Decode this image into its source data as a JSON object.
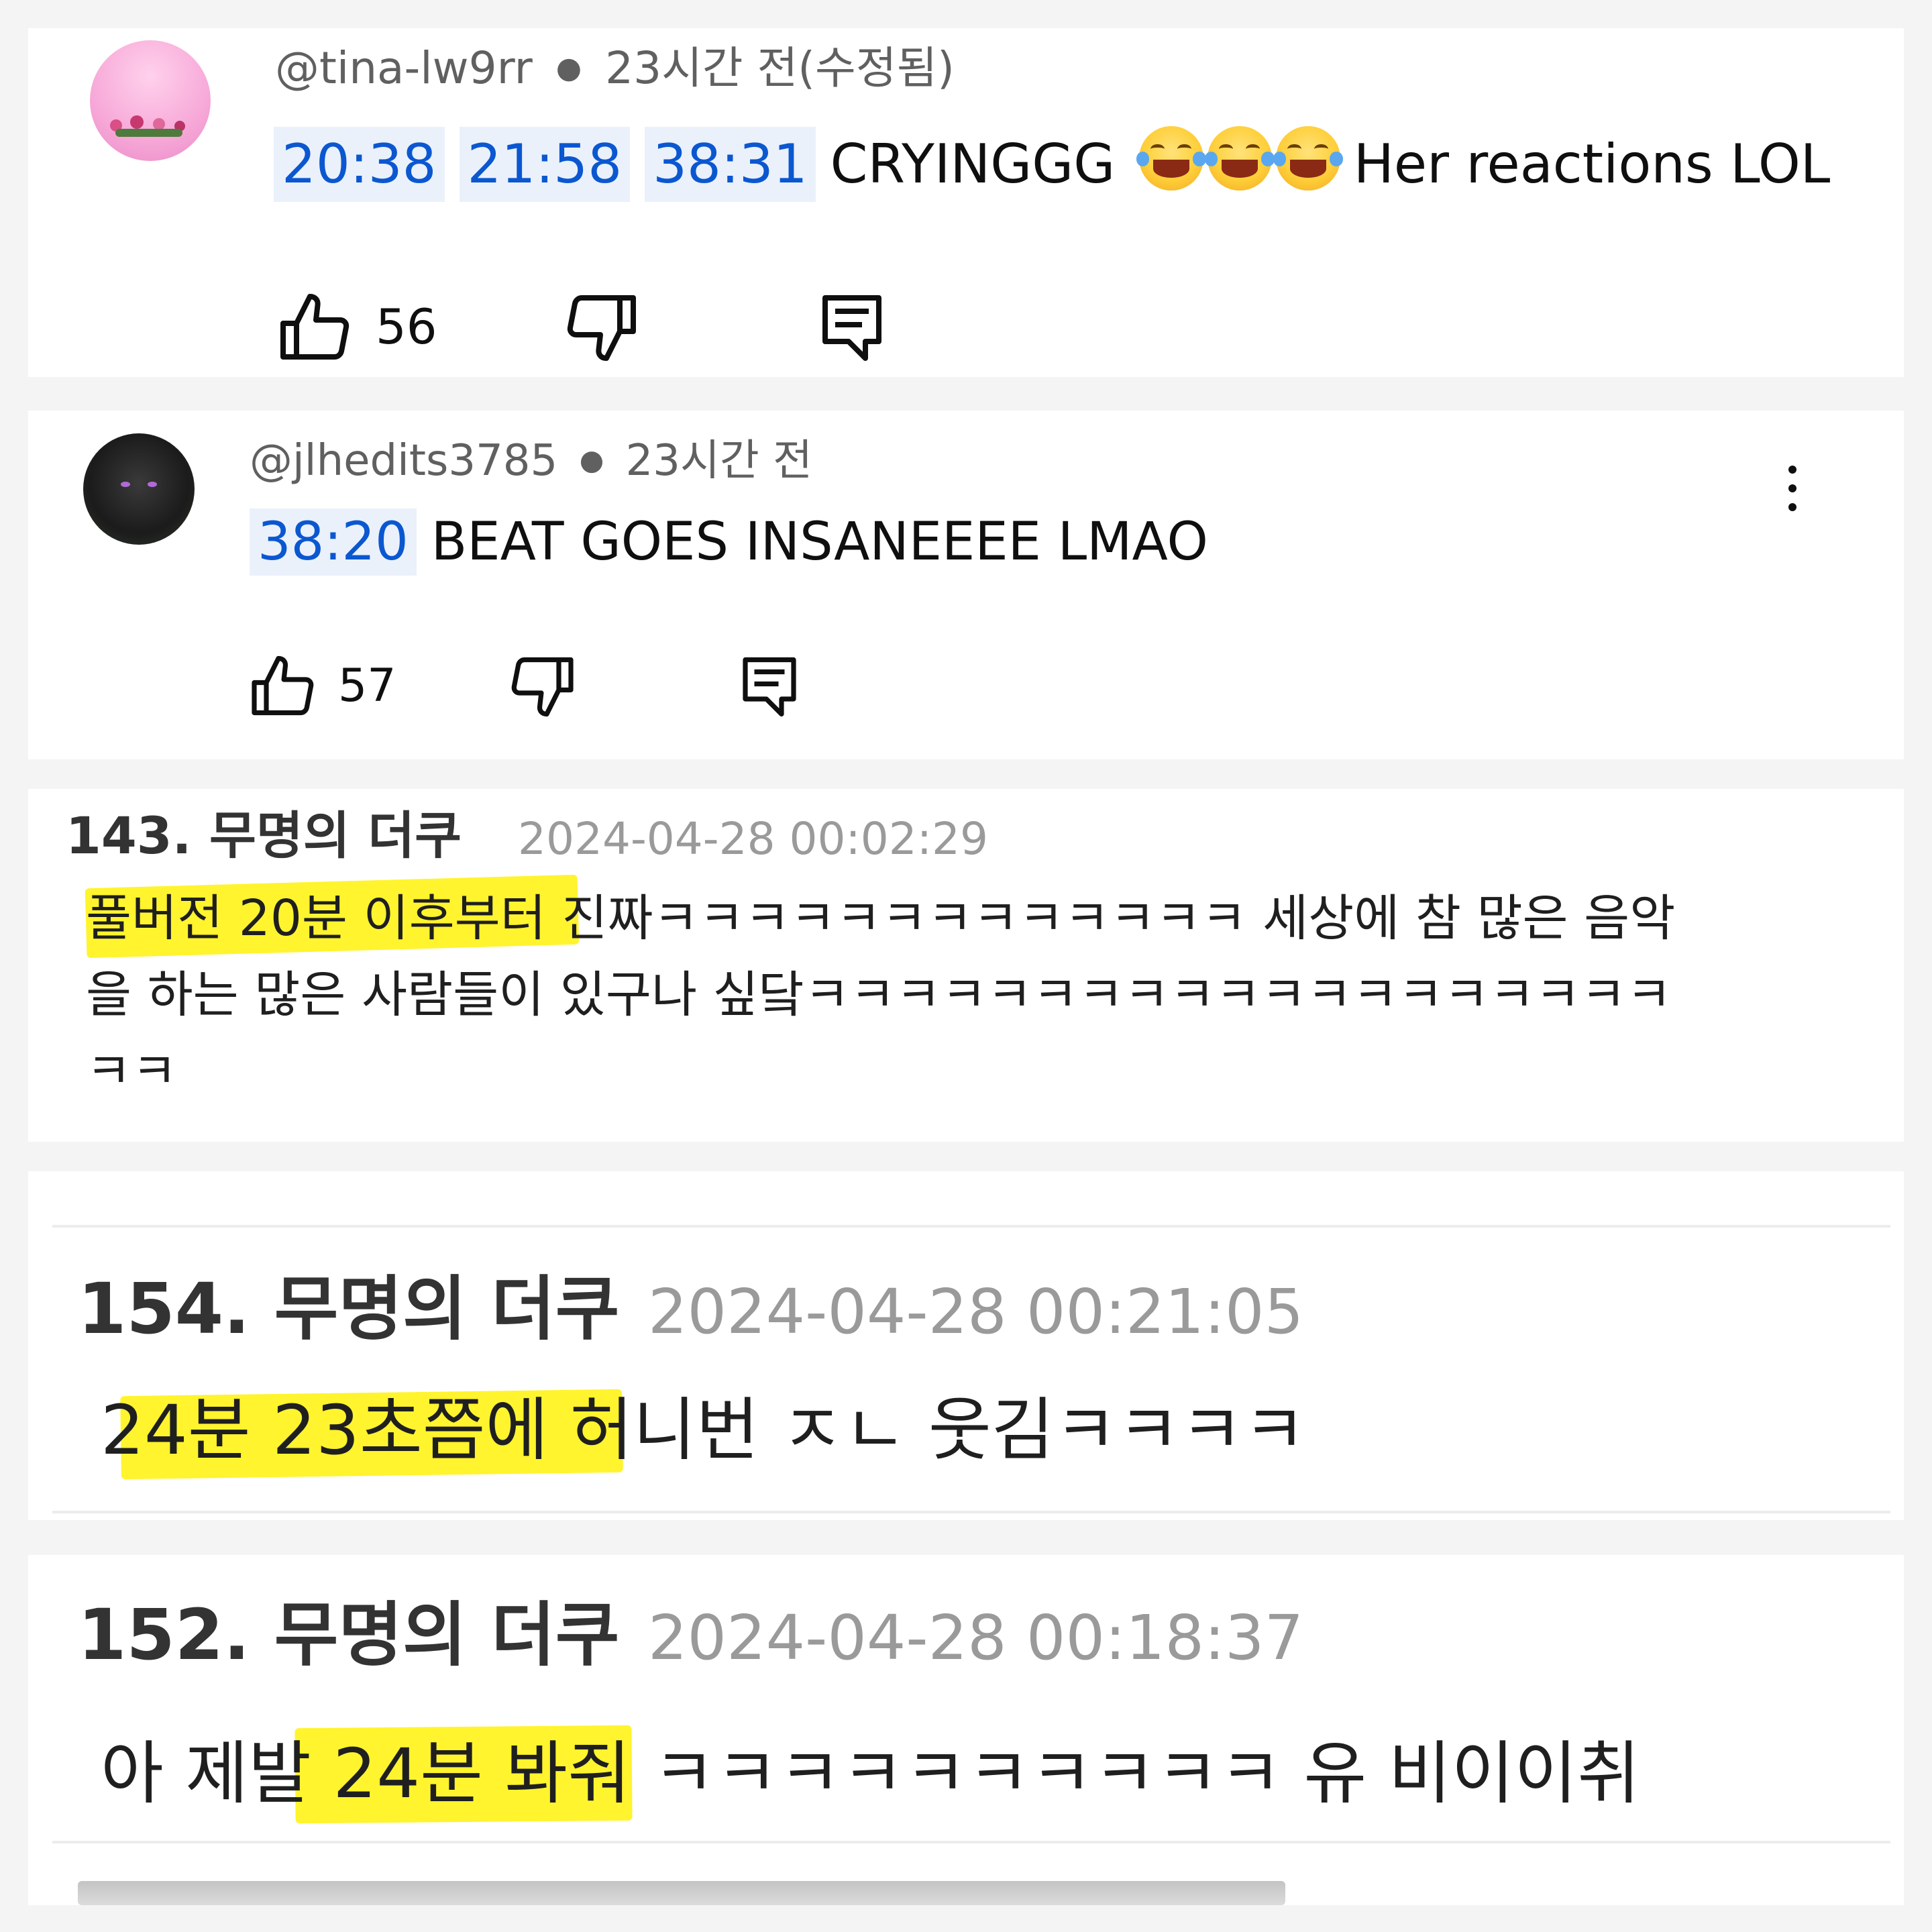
{
  "comment1": {
    "handle": "@tina-lw9rr",
    "meta": "23시간 전(수정됨)",
    "timestamps": [
      "20:38",
      "21:58",
      "38:31"
    ],
    "text_before": "CRYINGGG",
    "emoji": "face-with-tears-of-joy",
    "text_after": "Her reactions LOL",
    "likes": "56"
  },
  "comment2": {
    "handle": "@jlhedits3785",
    "meta": "23시간 전",
    "timestamps": [
      "38:20"
    ],
    "text": "BEAT GOES INSANEEEE LMAO",
    "likes": "57"
  },
  "post143": {
    "title": "143. 무명의 더쿠",
    "date": "2024-04-28 00:02:29",
    "lines": [
      "풀버전 20분 이후부터 진짜ㅋㅋㅋㅋㅋㅋㅋㅋㅋㅋㅋㅋㅋ 세상에 참 많은 음악",
      "을 하는 많은 사람들이 있구나 싶닼ㅋㅋㅋㅋㅋㅋㅋㅋㅋㅋㅋㅋㅋㅋㅋㅋㅋㅋㅋ",
      "ㅋㅋ"
    ]
  },
  "post154": {
    "title": "154. 무명의 더쿠",
    "date": "2024-04-28 00:21:05",
    "text": "24분 23초쯤에 허니번 ㅈㄴ 웃김ㅋㅋㅋㅋ"
  },
  "post152": {
    "title": "152. 무명의 더쿠",
    "date": "2024-04-28 00:18:37",
    "text": "아 제발 24분 봐줘 ㅋㅋㅋㅋㅋㅋㅋㅋㅋㅋ 유 비이이취"
  },
  "colors": {
    "timestamp_link": "#0b57d0",
    "timestamp_bg": "#eaf1fb",
    "highlight": "#fff200"
  }
}
